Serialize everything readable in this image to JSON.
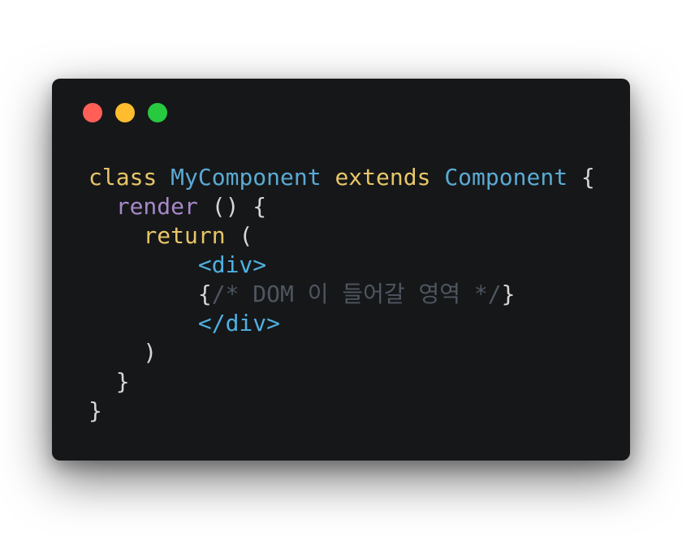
{
  "window": {
    "controls": [
      {
        "name": "close",
        "color": "#ff5f56"
      },
      {
        "name": "minimize",
        "color": "#ffbd2e"
      },
      {
        "name": "maximize",
        "color": "#27c93f"
      }
    ]
  },
  "colors": {
    "background": "#161719",
    "keyword": "#e7c668",
    "class_name": "#5aaad3",
    "method": "#a689c9",
    "punctuation": "#d6d6d6",
    "tag": "#4fb0e0",
    "comment": "#4e5660"
  },
  "code": {
    "lines": [
      [
        {
          "text": "class",
          "type": "keyword"
        },
        {
          "text": " ",
          "type": "plain"
        },
        {
          "text": "MyComponent",
          "type": "class"
        },
        {
          "text": " ",
          "type": "plain"
        },
        {
          "text": "extends",
          "type": "keyword"
        },
        {
          "text": " ",
          "type": "plain"
        },
        {
          "text": "Component",
          "type": "class"
        },
        {
          "text": " {",
          "type": "punct"
        }
      ],
      [
        {
          "text": "  ",
          "type": "plain"
        },
        {
          "text": "render",
          "type": "method"
        },
        {
          "text": " () {",
          "type": "punct"
        }
      ],
      [
        {
          "text": "    ",
          "type": "plain"
        },
        {
          "text": "return",
          "type": "keyword"
        },
        {
          "text": " (",
          "type": "punct"
        }
      ],
      [
        {
          "text": "        ",
          "type": "plain"
        },
        {
          "text": "<div>",
          "type": "tag"
        }
      ],
      [
        {
          "text": "        ",
          "type": "plain"
        },
        {
          "text": "{",
          "type": "punct"
        },
        {
          "text": "/* DOM 이 들어갈 영역 */",
          "type": "comment"
        },
        {
          "text": "}",
          "type": "punct"
        }
      ],
      [
        {
          "text": "        ",
          "type": "plain"
        },
        {
          "text": "</div>",
          "type": "tag"
        }
      ],
      [
        {
          "text": "    )",
          "type": "punct"
        }
      ],
      [
        {
          "text": "  }",
          "type": "punct"
        }
      ],
      [
        {
          "text": "}",
          "type": "punct"
        }
      ]
    ]
  }
}
